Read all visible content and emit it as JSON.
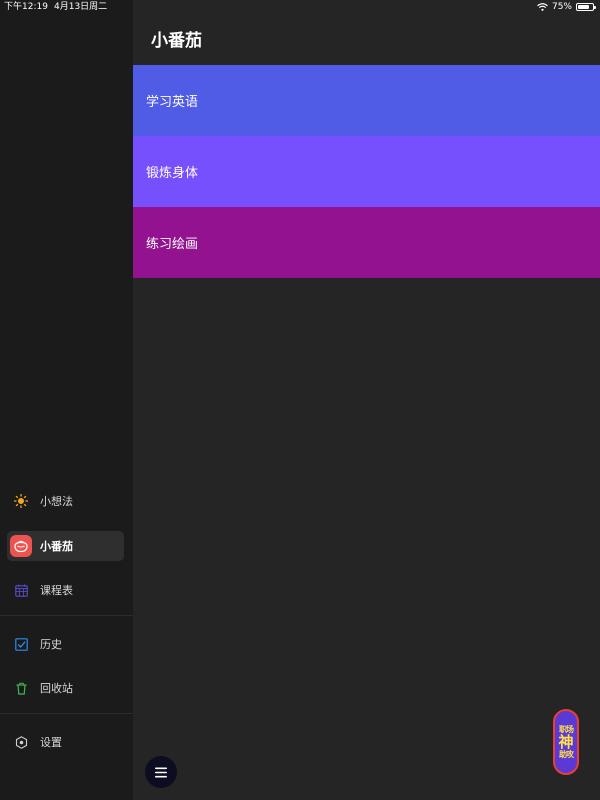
{
  "status_bar": {
    "time": "下午12:19",
    "date": "4月13日周二",
    "battery": "75%",
    "battery_level": 0.75
  },
  "sidebar": {
    "items": [
      {
        "label": "小想法",
        "icon": "sun-icon",
        "icon_color": "#f5a623"
      },
      {
        "label": "小番茄",
        "icon": "tomato-icon",
        "icon_color": "#ef5350",
        "active": true
      },
      {
        "label": "课程表",
        "icon": "calendar-icon",
        "icon_color": "#5a4fcf"
      },
      {
        "label": "历史",
        "icon": "checkbox-icon",
        "icon_color": "#2d8cf0"
      },
      {
        "label": "回收站",
        "icon": "trash-icon",
        "icon_color": "#3fb950"
      },
      {
        "label": "设置",
        "icon": "settings-hex-icon",
        "icon_color": "#cfcfcf"
      }
    ]
  },
  "main": {
    "title": "小番茄",
    "tasks": [
      {
        "label": "学习英语",
        "color": "#505ce6"
      },
      {
        "label": "锻炼身体",
        "color": "#7750fe"
      },
      {
        "label": "练习绘画",
        "color": "#93128f"
      }
    ]
  },
  "menu_button": {
    "icon": "menu-icon"
  },
  "watermark": {
    "top": "职场",
    "middle": "神",
    "bottom": "助攻"
  },
  "colors": {
    "sidebar_bg": "#1b1b1b",
    "main_bg": "#252525"
  }
}
